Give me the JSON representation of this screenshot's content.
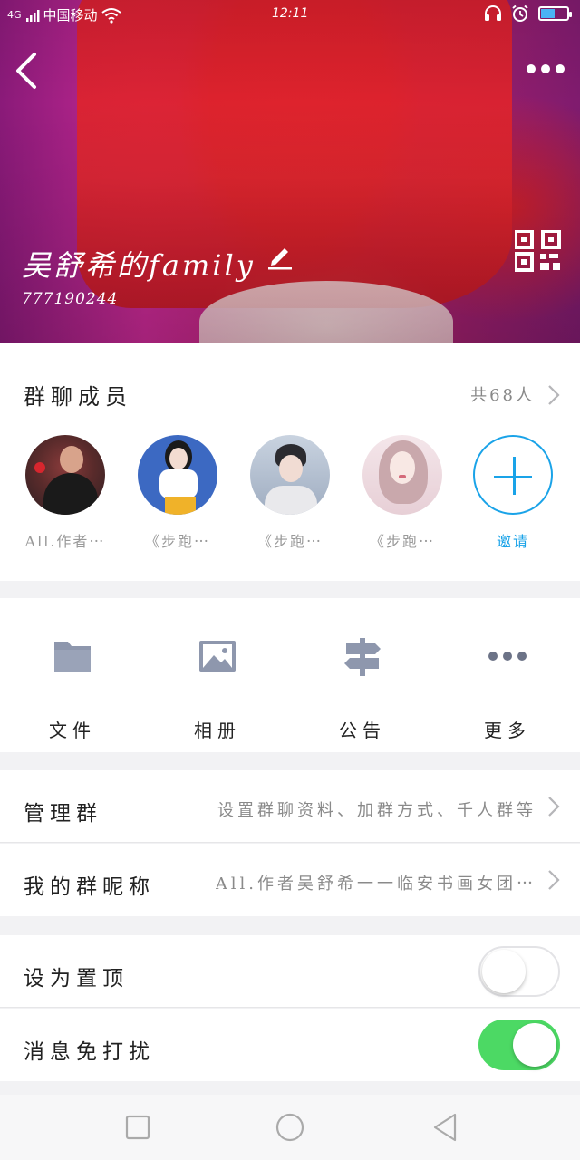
{
  "status_bar": {
    "network": "4G",
    "carrier": "中国移动",
    "time": "12:11",
    "battery_level": 0.55,
    "battery_color": "#4ab3f4"
  },
  "header": {
    "group_name": "吴舒希的family",
    "group_id": "777190244"
  },
  "members": {
    "title": "群聊成员",
    "count_text": "共68人",
    "items": [
      {
        "name": "All.作者⋯"
      },
      {
        "name": "《步跑⋯"
      },
      {
        "name": "《步跑⋯"
      },
      {
        "name": "《步跑⋯"
      }
    ],
    "invite_label": "邀请",
    "accent_color": "#1aa3e8"
  },
  "tools": [
    {
      "label": "文件",
      "icon": "folder-icon"
    },
    {
      "label": "相册",
      "icon": "image-icon"
    },
    {
      "label": "公告",
      "icon": "signpost-icon"
    },
    {
      "label": "更多",
      "icon": "more-dots-icon"
    }
  ],
  "settings": {
    "manage": {
      "label": "管理群",
      "value": "设置群聊资料、加群方式、千人群等"
    },
    "nickname": {
      "label": "我的群昵称",
      "value": "All.作者吴舒希一一临安书画女团⋯"
    },
    "pin": {
      "label": "设为置顶",
      "enabled": false
    },
    "mute": {
      "label": "消息免打扰",
      "enabled": true,
      "on_color": "#4cd964"
    }
  }
}
